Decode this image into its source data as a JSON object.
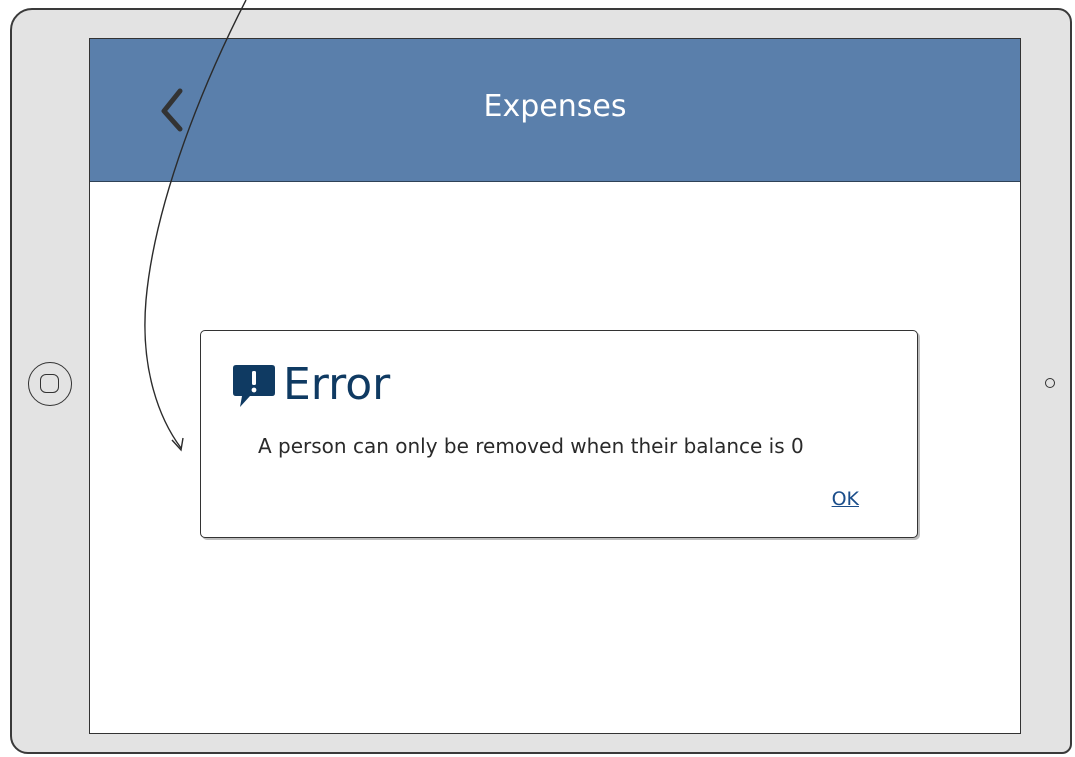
{
  "app": {
    "title": "Expenses"
  },
  "dialog": {
    "title": "Error",
    "message": "A person can only be removed when their balance is 0",
    "ok_label": "OK"
  },
  "colors": {
    "appbar": "#5a7fab",
    "dialog_title": "#0f3a62",
    "link": "#1a4d8a"
  },
  "icons": {
    "back": "chevron-left-icon",
    "error": "alert-speech-bubble-icon",
    "home": "home-button-icon"
  }
}
